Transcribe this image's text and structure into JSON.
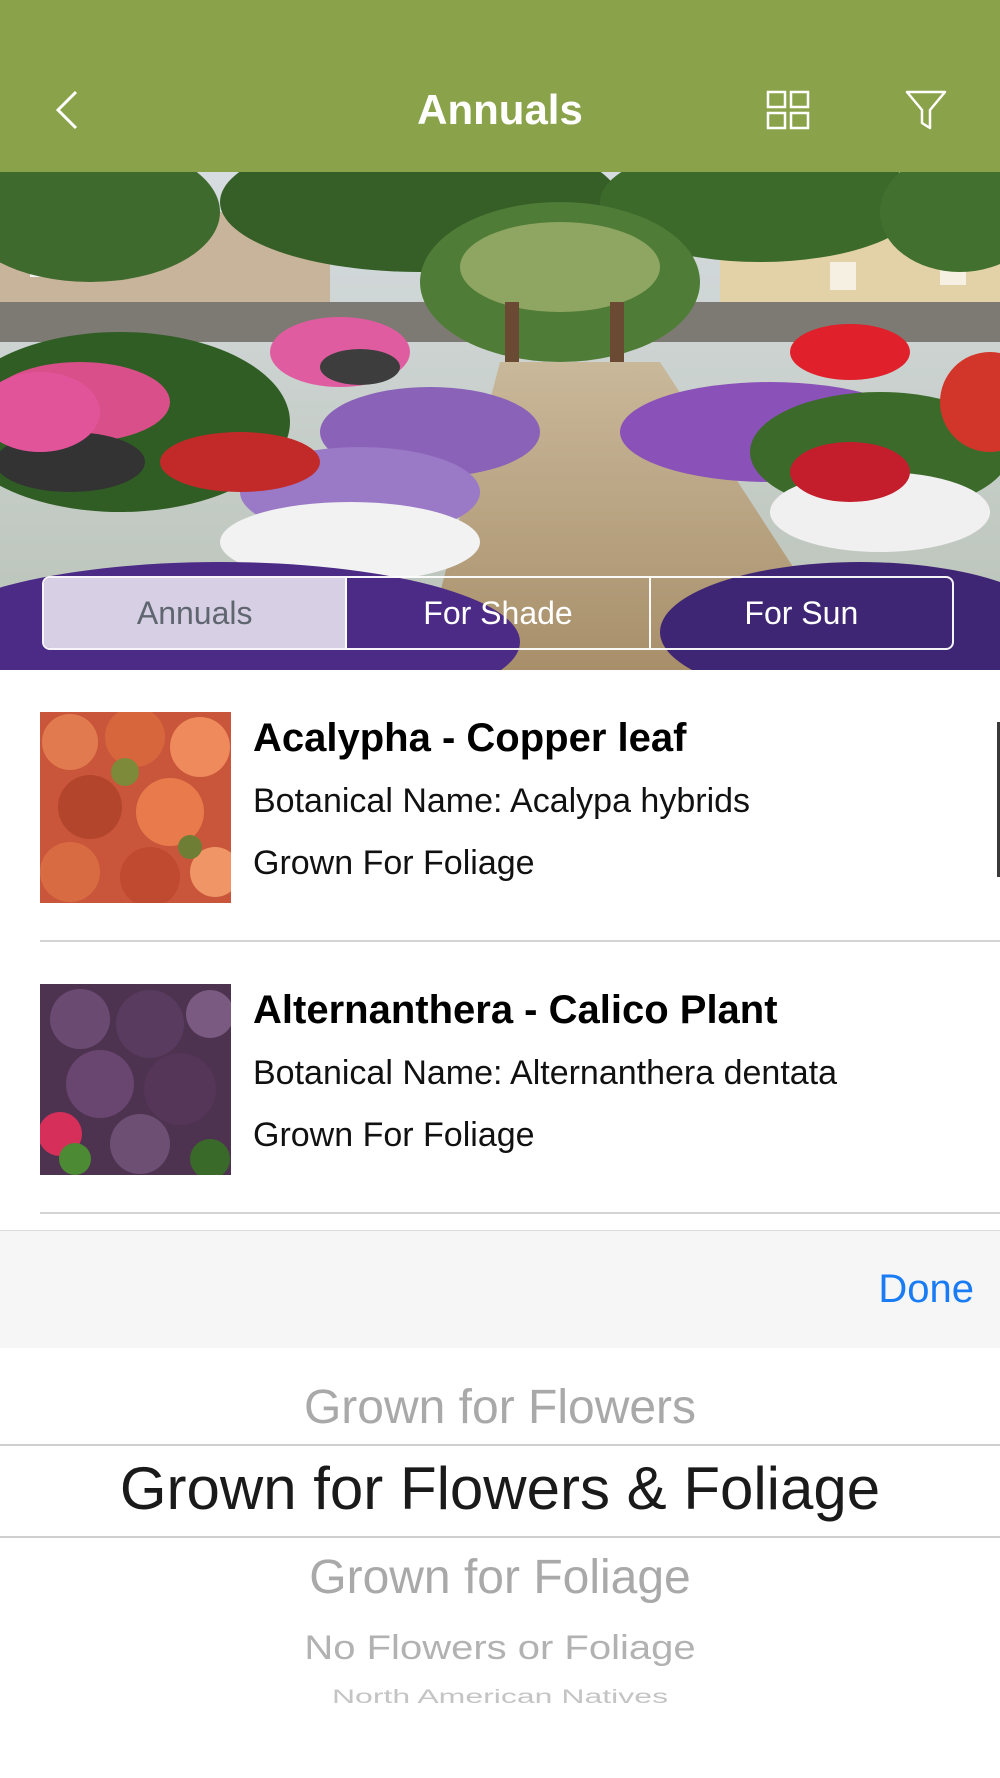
{
  "header": {
    "title": "Annuals",
    "back_icon": "chevron-left-icon",
    "grid_icon": "grid-view-icon",
    "filter_icon": "filter-icon",
    "background_color": "#8aa24a"
  },
  "hero": {
    "segments": [
      "Annuals",
      "For Shade",
      "For Sun"
    ],
    "selected_segment": "Annuals"
  },
  "plants": [
    {
      "name": "Acalypha - Copper leaf",
      "botanical": "Botanical Name: Acalypa hybrids",
      "grown": "Grown For Foliage"
    },
    {
      "name": "Alternanthera - Calico Plant",
      "botanical": "Botanical Name: Alternanthera dentata",
      "grown": "Grown For Foliage"
    }
  ],
  "toolbar": {
    "done_label": "Done",
    "accent_color": "#1a7cf5"
  },
  "picker": {
    "options": [
      "Grown for Flowers",
      "Grown for Flowers & Foliage",
      "Grown for Foliage",
      "No Flowers or Foliage",
      "North American Natives"
    ],
    "selected": "Grown for Flowers & Foliage"
  }
}
